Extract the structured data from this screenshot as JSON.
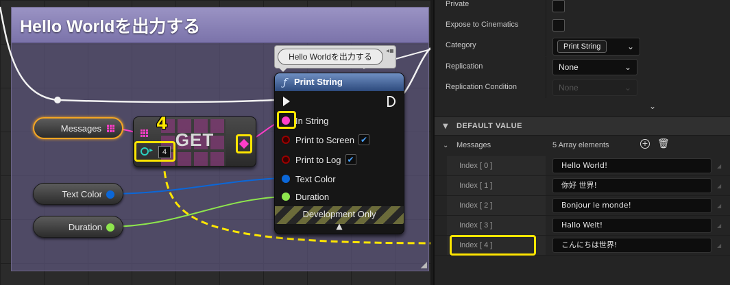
{
  "graph": {
    "comment_title": "Hello Worldを出力する",
    "bubble_text": "Hello Worldを出力する",
    "annotation_number": "4",
    "nodes": {
      "messages_label": "Messages",
      "text_color_label": "Text Color",
      "duration_label": "Duration",
      "get_label": "GET",
      "get_index_value": "4",
      "print_title": "Print String",
      "pins": {
        "in_string": "In String",
        "print_to_screen": "Print to Screen",
        "print_to_log": "Print to Log",
        "text_color": "Text Color",
        "duration": "Duration"
      },
      "dev_only": "Development Only"
    },
    "colors": {
      "string_pin": "#ff3ec9",
      "bool_pin": "#9b0000",
      "color_pin": "#0b67d8",
      "float_pin": "#8ee64d",
      "highlight": "#ffe600",
      "function_header": "#4b6fa8",
      "comment_header": "#8a83b8"
    }
  },
  "panel": {
    "rows": {
      "private_label": "Private",
      "expose_label": "Expose to Cinematics",
      "category_label": "Category",
      "category_value": "Print String",
      "replication_label": "Replication",
      "replication_value": "None",
      "replication_condition_label": "Replication Condition",
      "replication_condition_value": "None"
    },
    "section_title": "DEFAULT VALUE",
    "array": {
      "label": "Messages",
      "count_text": "5 Array elements",
      "elements": [
        {
          "index": "Index [ 0 ]",
          "value": "Hello World!"
        },
        {
          "index": "Index [ 1 ]",
          "value": "你好 世界!"
        },
        {
          "index": "Index [ 2 ]",
          "value": "Bonjour le monde!"
        },
        {
          "index": "Index [ 3 ]",
          "value": "Hallo Welt!"
        },
        {
          "index": "Index [ 4 ]",
          "value": "こんにちは世界!"
        }
      ]
    }
  }
}
